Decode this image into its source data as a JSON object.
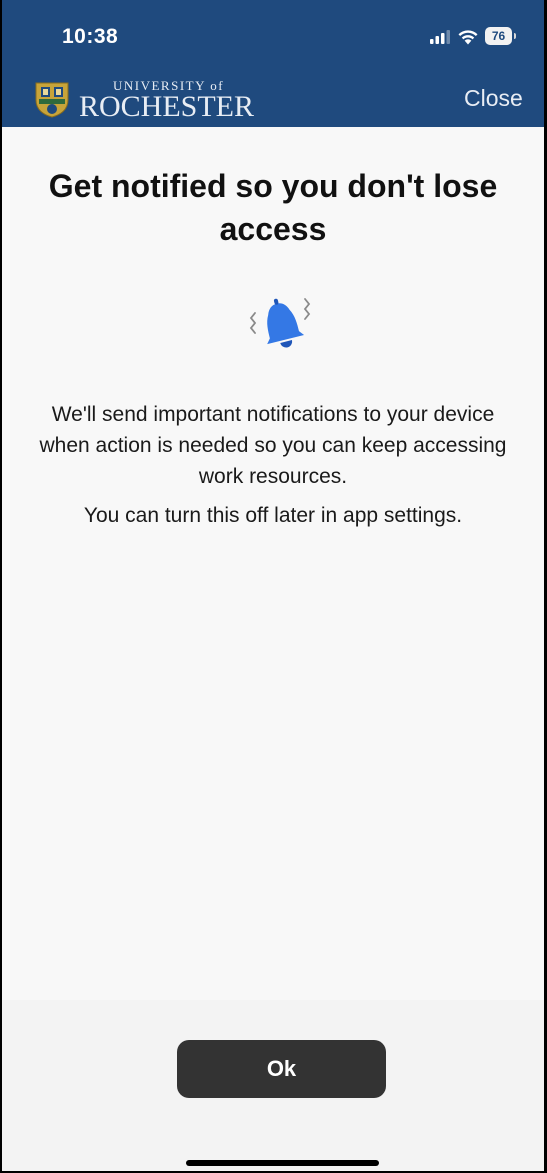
{
  "status_bar": {
    "time": "10:38",
    "battery_level": "76"
  },
  "header": {
    "logo_small_text": "UNIVERSITY of",
    "logo_big_text": "ROCHESTER",
    "close_label": "Close",
    "background_color": "#1f4a7e"
  },
  "content": {
    "title": "Get notified so you don't lose access",
    "paragraph_1": "We'll send important notifications to your device when action is needed so you can keep accessing work resources.",
    "paragraph_2": "You can turn this off later in app settings.",
    "icon": "notification-bell-icon",
    "icon_color": "#3478e5"
  },
  "footer": {
    "ok_label": "Ok",
    "button_color": "#333333"
  }
}
